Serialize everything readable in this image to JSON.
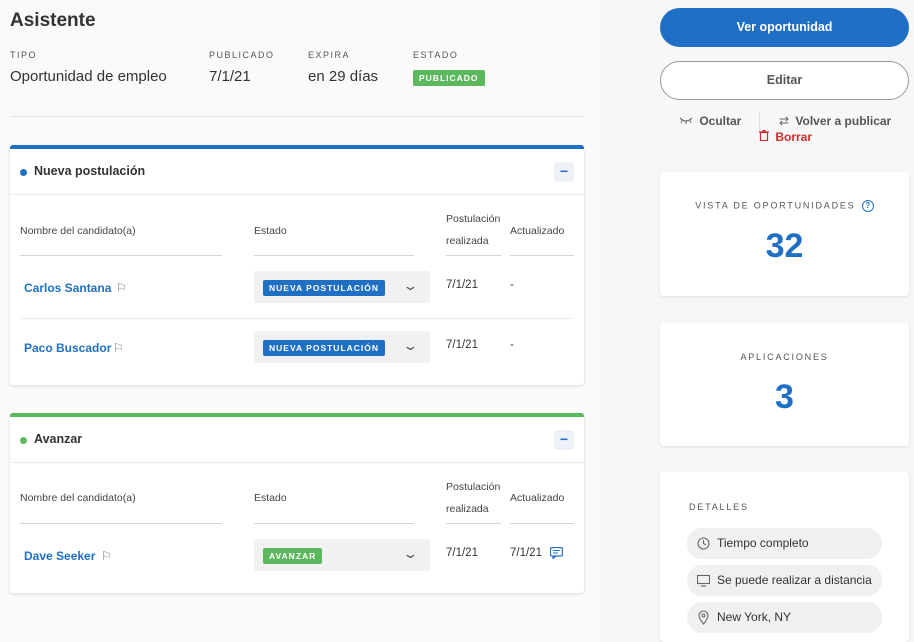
{
  "header": {
    "title": "Asistente",
    "meta": {
      "tipo_label": "TIPO",
      "tipo_value": "Oportunidad de empleo",
      "publicado_label": "PUBLICADO",
      "publicado_value": "7/1/21",
      "expira_label": "EXPIRA",
      "expira_value": "en 29 días",
      "estado_label": "ESTADO",
      "estado_value": "PUBLICADO"
    }
  },
  "columns": {
    "candidate": "Nombre del candidato(a)",
    "status": "Estado",
    "applied_line1": "Postulación",
    "applied_line2": "realizada",
    "updated": "Actualizado"
  },
  "sections": [
    {
      "title": "Nueva postulación",
      "collapse_icon": "minus",
      "rows": [
        {
          "name": "Carlos Santana",
          "status": "NUEVA POSTULACIÓN",
          "applied": "7/1/21",
          "updated": "-"
        },
        {
          "name": "Paco Buscador",
          "status": "NUEVA POSTULACIÓN",
          "applied": "7/1/21",
          "updated": "-"
        }
      ]
    },
    {
      "title": "Avanzar",
      "collapse_icon": "minus",
      "rows": [
        {
          "name": "Dave Seeker",
          "status": "AVANZAR",
          "applied": "7/1/21",
          "updated": "7/1/21"
        }
      ]
    }
  ],
  "sidebar": {
    "view_button": "Ver oportunidad",
    "edit_button": "Editar",
    "hide_label": "Ocultar",
    "republish_label": "Volver a publicar",
    "delete_label": "Borrar",
    "views_label": "VISTA DE OPORTUNIDADES",
    "views_value": "32",
    "applications_label": "APLICACIONES",
    "applications_value": "3",
    "details_label": "DETALLES",
    "details": [
      {
        "icon": "clock-icon",
        "text": "Tiempo completo"
      },
      {
        "icon": "monitor-icon",
        "text": "Se puede realizar a distancia"
      },
      {
        "icon": "location-pin-icon",
        "text": "New York, NY"
      }
    ]
  },
  "colors": {
    "accent": "#1f6fc5",
    "success": "#5cb85c",
    "danger": "#c9302c"
  }
}
